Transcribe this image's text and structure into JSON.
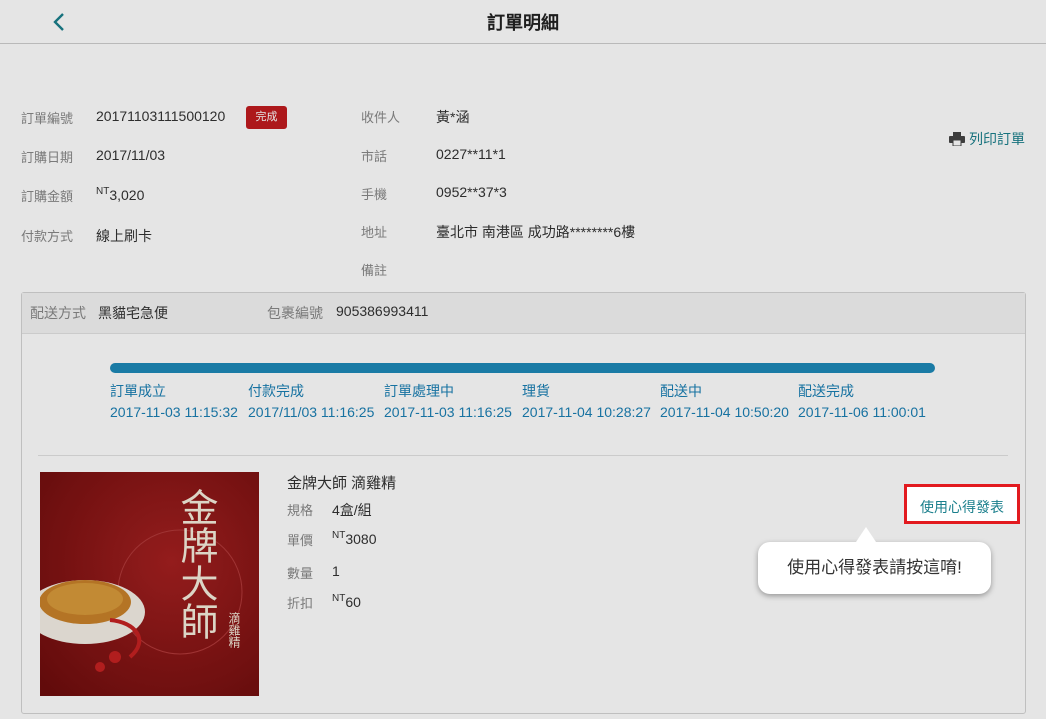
{
  "header": {
    "title": "訂單明細",
    "back_icon": "chevron-left-icon"
  },
  "order": {
    "number_label": "訂單編號",
    "number": "20171103111500120",
    "status": "完成",
    "date_label": "訂購日期",
    "date": "2017/11/03",
    "amount_label": "訂購金額",
    "currency": "NT",
    "amount": "3,020",
    "payment_label": "付款方式",
    "payment": "線上刷卡"
  },
  "recipient": {
    "name_label": "收件人",
    "name": "黃*涵",
    "phone_label": "市話",
    "phone": "0227**11*1",
    "mobile_label": "手機",
    "mobile": "0952**37*3",
    "address_label": "地址",
    "address": "臺北市 南港區 成功路********6樓",
    "note_label": "備註",
    "note": ""
  },
  "print": {
    "label": "列印訂單",
    "icon": "printer-icon"
  },
  "shipping": {
    "method_label": "配送方式",
    "method": "黑貓宅急便",
    "tracking_label": "包裹編號",
    "tracking": "905386993411",
    "progress": 1.0,
    "steps": [
      {
        "label": "訂單成立",
        "time": "2017-11-03 11:15:32"
      },
      {
        "label": "付款完成",
        "time": "2017/11/03 11:16:25"
      },
      {
        "label": "訂單處理中",
        "time": "2017-11-03 11:16:25"
      },
      {
        "label": "理貨",
        "time": "2017-11-04 10:28:27"
      },
      {
        "label": "配送中",
        "time": "2017-11-04 10:50:20"
      },
      {
        "label": "配送完成",
        "time": "2017-11-06 11:00:01"
      }
    ]
  },
  "product": {
    "name": "金牌大師 滴雞精",
    "spec_label": "規格",
    "spec": "4盒/組",
    "price_label": "單價",
    "price_currency": "NT",
    "price": "3080",
    "qty_label": "數量",
    "qty": "1",
    "discount_label": "折扣",
    "discount_currency": "NT",
    "discount": "60",
    "image_text": "金牌大師",
    "image_subtext": "滴雞精"
  },
  "review": {
    "button_label": "使用心得發表",
    "tooltip": "使用心得發表請按這唷!"
  }
}
